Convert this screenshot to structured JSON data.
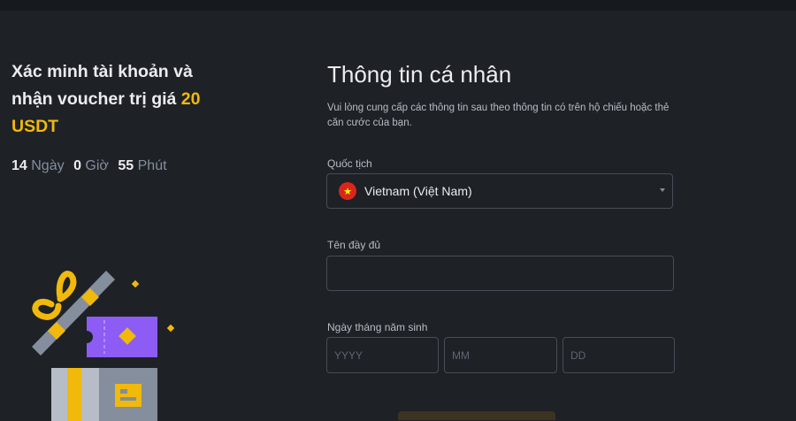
{
  "promo": {
    "title_part1": "Xác minh tài khoản và nhận voucher trị giá ",
    "title_highlight": "20 USDT",
    "countdown": {
      "days_value": "14",
      "days_unit": "Ngày",
      "hours_value": "0",
      "hours_unit": "Giờ",
      "minutes_value": "55",
      "minutes_unit": "Phút"
    }
  },
  "form": {
    "title": "Thông tin cá nhân",
    "description": "Vui lòng cung cấp các thông tin sau theo thông tin có trên hộ chiếu hoặc thẻ căn cước của bạn.",
    "nationality_label": "Quốc tịch",
    "nationality_value": "Vietnam (Việt Nam)",
    "fullname_label": "Tên đầy đủ",
    "fullname_value": "",
    "dob_label": "Ngày tháng năm sinh",
    "dob_year_placeholder": "YYYY",
    "dob_month_placeholder": "MM",
    "dob_day_placeholder": "DD"
  },
  "icons": {
    "flag": "vietnam-flag-icon",
    "caret": "caret-down-icon",
    "illustration": "gift-voucher-illustration"
  },
  "colors": {
    "accent": "#f0b90b",
    "background": "#1e2126",
    "voucher": "#8c5cf5"
  }
}
